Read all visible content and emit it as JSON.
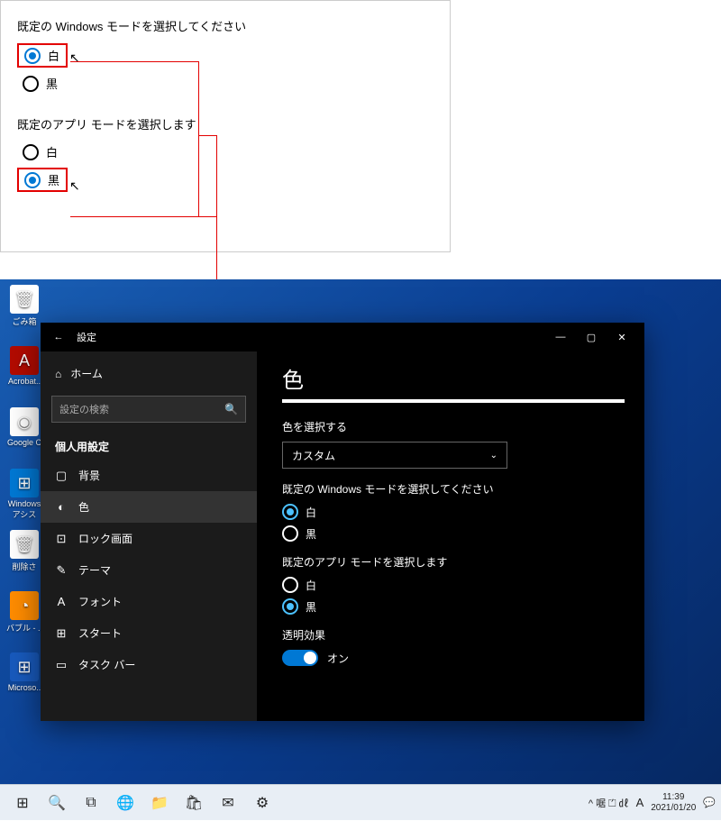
{
  "topPanel": {
    "winModeTitle": "既定の Windows モードを選択してください",
    "appModeTitle": "既定のアプリ モードを選択します",
    "optWhite": "白",
    "optBlack": "黒"
  },
  "desktopIcons": [
    "ごみ箱",
    "Acrobat..",
    "Google C",
    "Windows アシス",
    "削除さ",
    "バブル - ..",
    "Microso.."
  ],
  "settings": {
    "windowTitle": "設定",
    "home": "ホーム",
    "searchPlaceholder": "設定の検索",
    "category": "個人用設定",
    "nav": [
      {
        "icon": "▢",
        "label": "背景"
      },
      {
        "icon": "◐",
        "label": "色",
        "active": true
      },
      {
        "icon": "⊡",
        "label": "ロック画面"
      },
      {
        "icon": "✎",
        "label": "テーマ"
      },
      {
        "icon": "A",
        "label": "フォント"
      },
      {
        "icon": "⊞",
        "label": "スタート"
      },
      {
        "icon": "▭",
        "label": "タスク バー"
      }
    ],
    "pageTitle": "色",
    "chooseColor": "色を選択する",
    "colorValue": "カスタム",
    "winModeTitle": "既定の Windows モードを選択してください",
    "appModeTitle": "既定のアプリ モードを選択します",
    "optWhite": "白",
    "optBlack": "黒",
    "transparency": "透明効果",
    "on": "オン"
  },
  "taskbar": {
    "time": "11:39",
    "date": "2021/01/20",
    "ime": "A",
    "tray": "^ 啹 ⏍ ㎗"
  }
}
